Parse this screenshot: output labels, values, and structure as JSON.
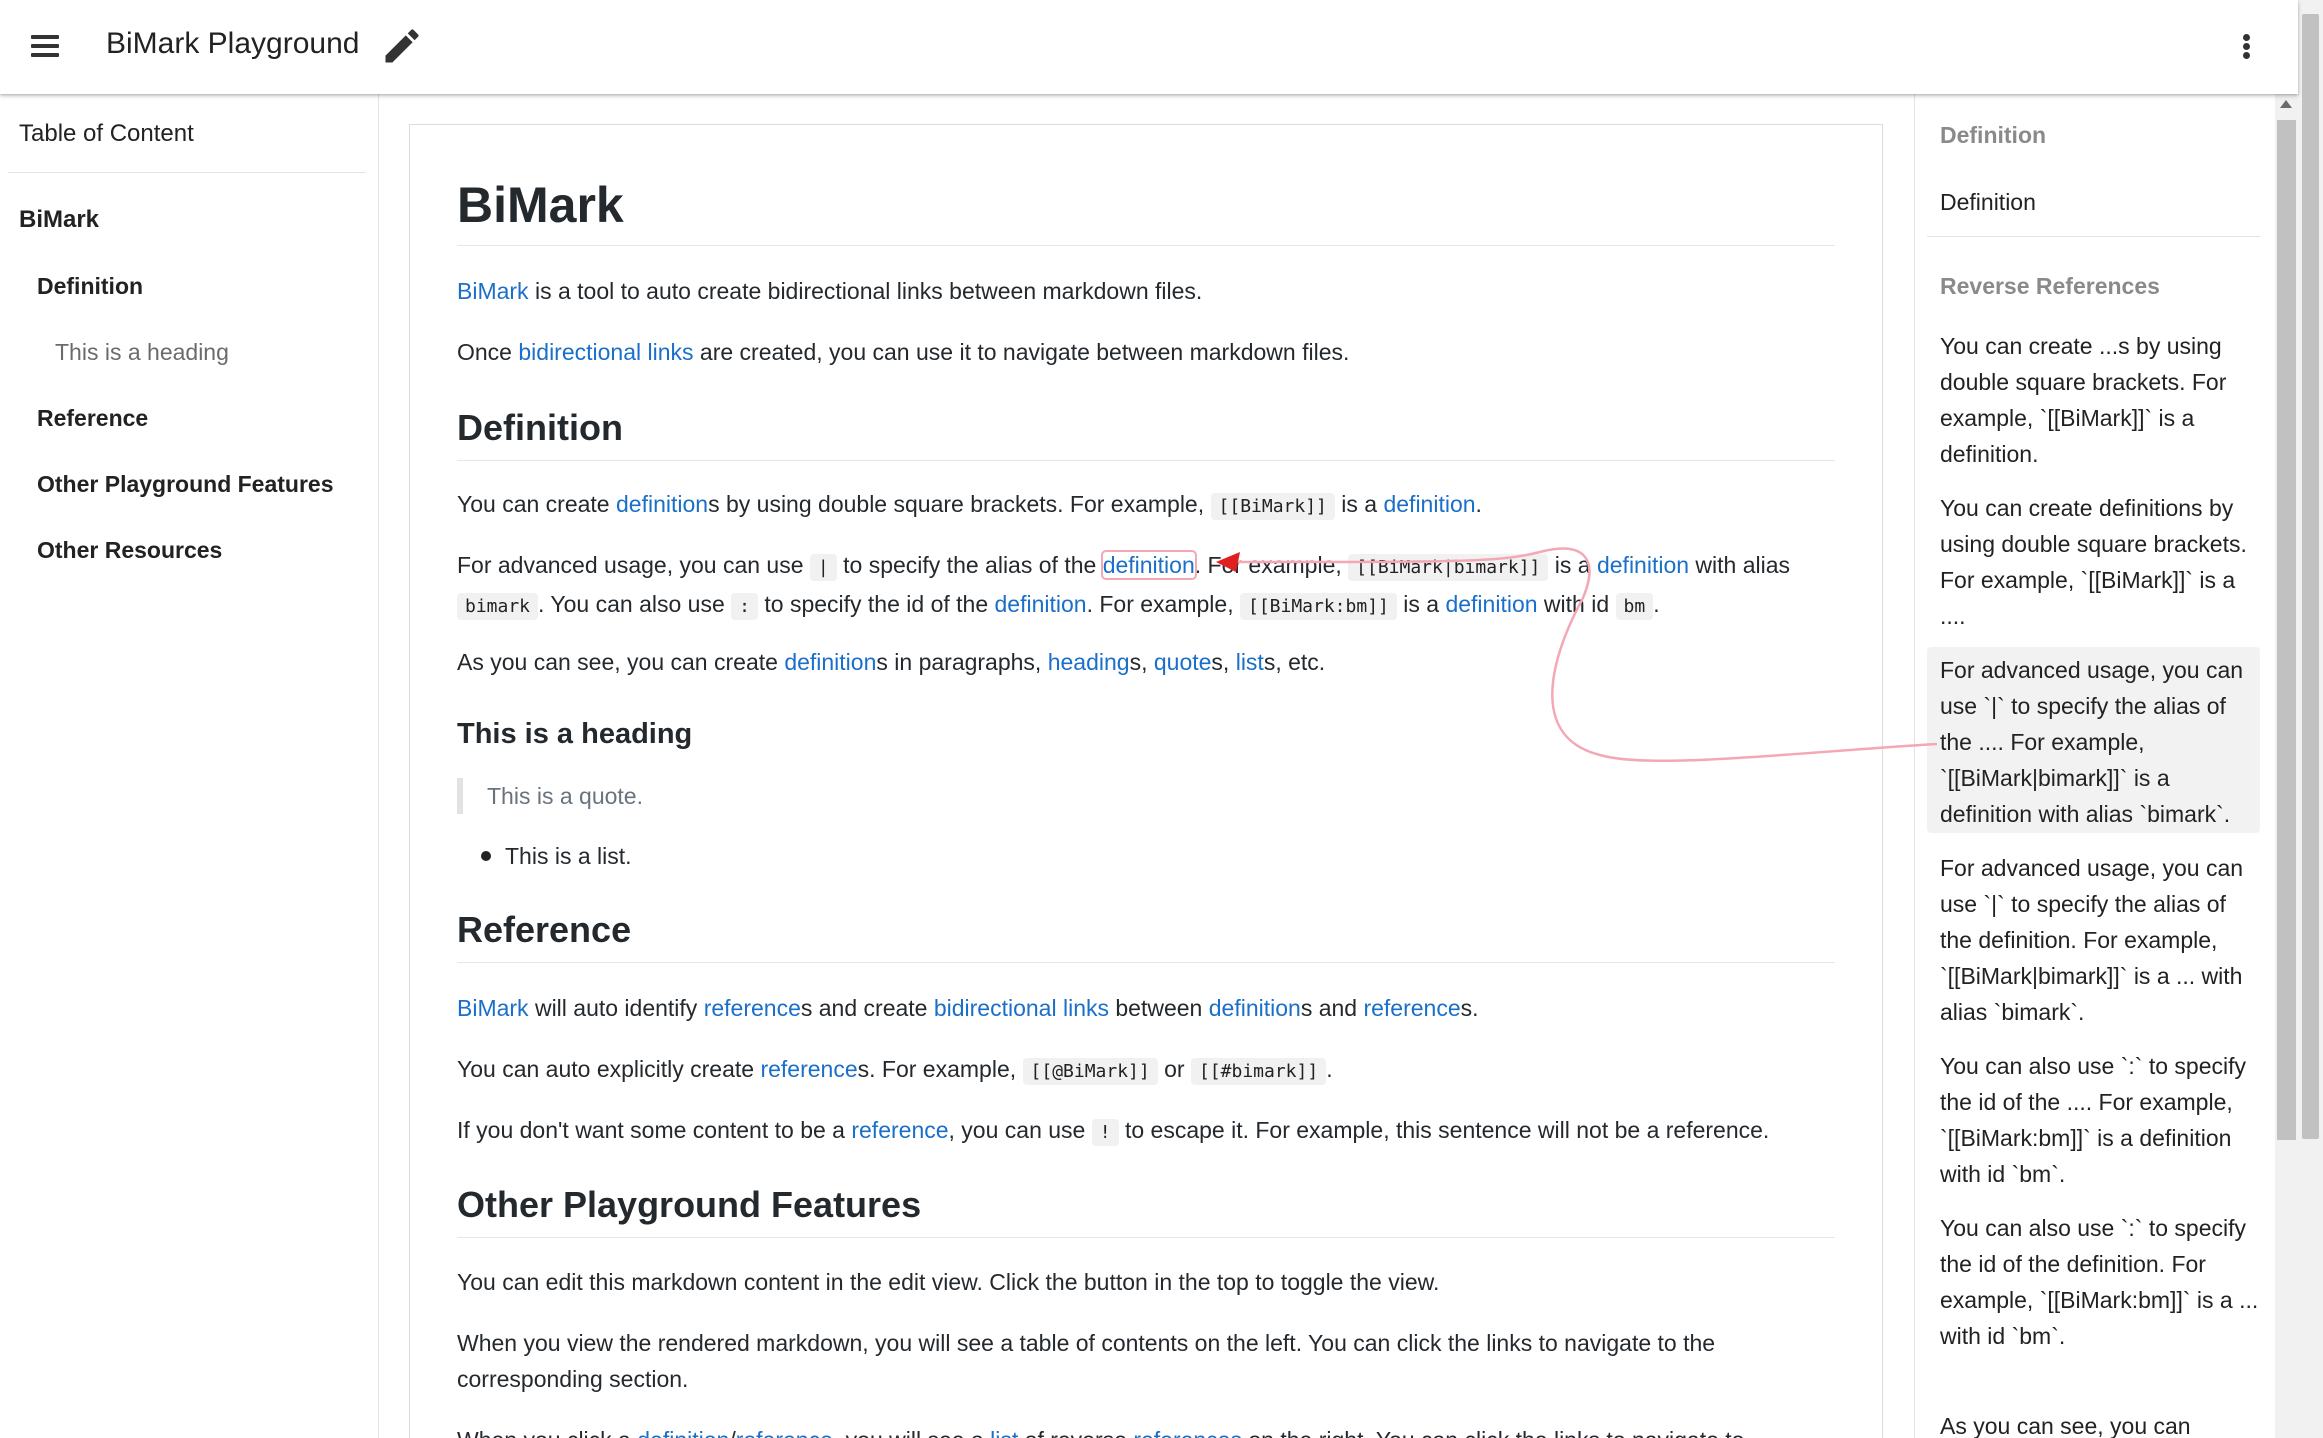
{
  "app": {
    "title": "BiMark Playground"
  },
  "toc": {
    "header": "Table of Content",
    "items": [
      {
        "label": "BiMark",
        "level": 1
      },
      {
        "label": "Definition",
        "level": 2
      },
      {
        "label": "This is a heading",
        "level": 3
      },
      {
        "label": "Reference",
        "level": 2
      },
      {
        "label": "Other Playground Features",
        "level": 2
      },
      {
        "label": "Other Resources",
        "level": 2
      }
    ]
  },
  "content": {
    "h1": "BiMark",
    "intro": {
      "link1": "BiMark",
      "text1": " is a tool to auto create bidirectional links between markdown files."
    },
    "intro2": {
      "text1": "Once ",
      "link1": "bidirectional links",
      "text2": " are created, you can use it to navigate between markdown files."
    },
    "def_heading": "Definition",
    "def_p1": {
      "t1": "You can create ",
      "l1": "definition",
      "t2": "s by using double square brackets. For example, ",
      "c1": "[[BiMark]]",
      "t3": " is a ",
      "l2": "definition",
      "t4": "."
    },
    "def_p2": {
      "t1": "For advanced usage, you can use ",
      "c1": "|",
      "t2": " to specify the alias of the ",
      "l1": "definition",
      "t3": ". For example, ",
      "c2": "[[BiMark|bimark]]",
      "t4": " is a ",
      "l2": "definition",
      "t5": " with alias ",
      "c3": "bimark",
      "t6": ". You can also use ",
      "c4": ":",
      "t7": " to specify the id of the ",
      "l3": "definition",
      "t8": ". For example, ",
      "c5": "[[BiMark:bm]]",
      "t9": " is a ",
      "l4": "definition",
      "t10": " with id ",
      "c6": "bm",
      "t11": "."
    },
    "def_p3": {
      "t1": "As you can see, you can create ",
      "l1": "definition",
      "t2": "s in paragraphs, ",
      "l2": "heading",
      "t3": "s, ",
      "l3": "quote",
      "t4": "s, ",
      "l4": "list",
      "t5": "s, etc."
    },
    "h3": "This is a heading",
    "quote": "This is a quote.",
    "list_item": "This is a list.",
    "ref_heading": "Reference",
    "ref_p1": {
      "l1": "BiMark",
      "t1": " will auto identify ",
      "l2": "reference",
      "t2": "s and create ",
      "l3": "bidirectional links",
      "t3": " between ",
      "l4": "definition",
      "t4": "s and ",
      "l5": "reference",
      "t5": "s."
    },
    "ref_p2": {
      "t1": "You can auto explicitly create ",
      "l1": "reference",
      "t2": "s. For example, ",
      "c1": "[[@BiMark]]",
      "t3": " or ",
      "c2": "[[#bimark]]",
      "t4": "."
    },
    "ref_p3": {
      "t1": "If you don't want some content to be a ",
      "l1": "reference",
      "t2": ", you can use ",
      "c1": "!",
      "t3": " to escape it. For example, this sentence will not be a reference."
    },
    "other_heading": "Other Playground Features",
    "other_p1": "You can edit this markdown content in the edit view. Click the button in the top to toggle the view.",
    "other_p2": "When you view the rendered markdown, you will see a table of contents on the left. You can click the links to navigate to the corresponding section.",
    "other_p3": {
      "t1": "When you click a ",
      "l1": "definition",
      "t2": "/",
      "l2": "reference",
      "t3": ", you will see a ",
      "l3": "list",
      "t4": " of reverse ",
      "l4": "references",
      "t5": " on the right. You can click the links to navigate to"
    }
  },
  "right_panel": {
    "definition_header": "Definition",
    "definition_value": "Definition",
    "reverse_header": "Reverse References",
    "refs": [
      "You can create ...s by using double square brackets. For example, `[[BiMark]]` is a definition.",
      "You can create definitions by using double square brackets. For example, `[[BiMark]]` is a ....",
      "For advanced usage, you can use `|` to specify the alias of the .... For example, `[[BiMark|bimark]]` is a definition with alias `bimark`.",
      "For advanced usage, you can use `|` to specify the alias of the definition. For example, `[[BiMark|bimark]]` is a ... with alias `bimark`.",
      "You can also use `:` to specify the id of the .... For example, `[[BiMark:bm]]` is a definition with id `bm`.",
      "You can also use `:` to specify the id of the definition. For example, `[[BiMark:bm]]` is a ... with id `bm`.",
      "As you can see, you can"
    ]
  },
  "colors": {
    "link": "#1a6fc9",
    "arrow": "#e02020",
    "highlight": "#f4a7b4"
  }
}
